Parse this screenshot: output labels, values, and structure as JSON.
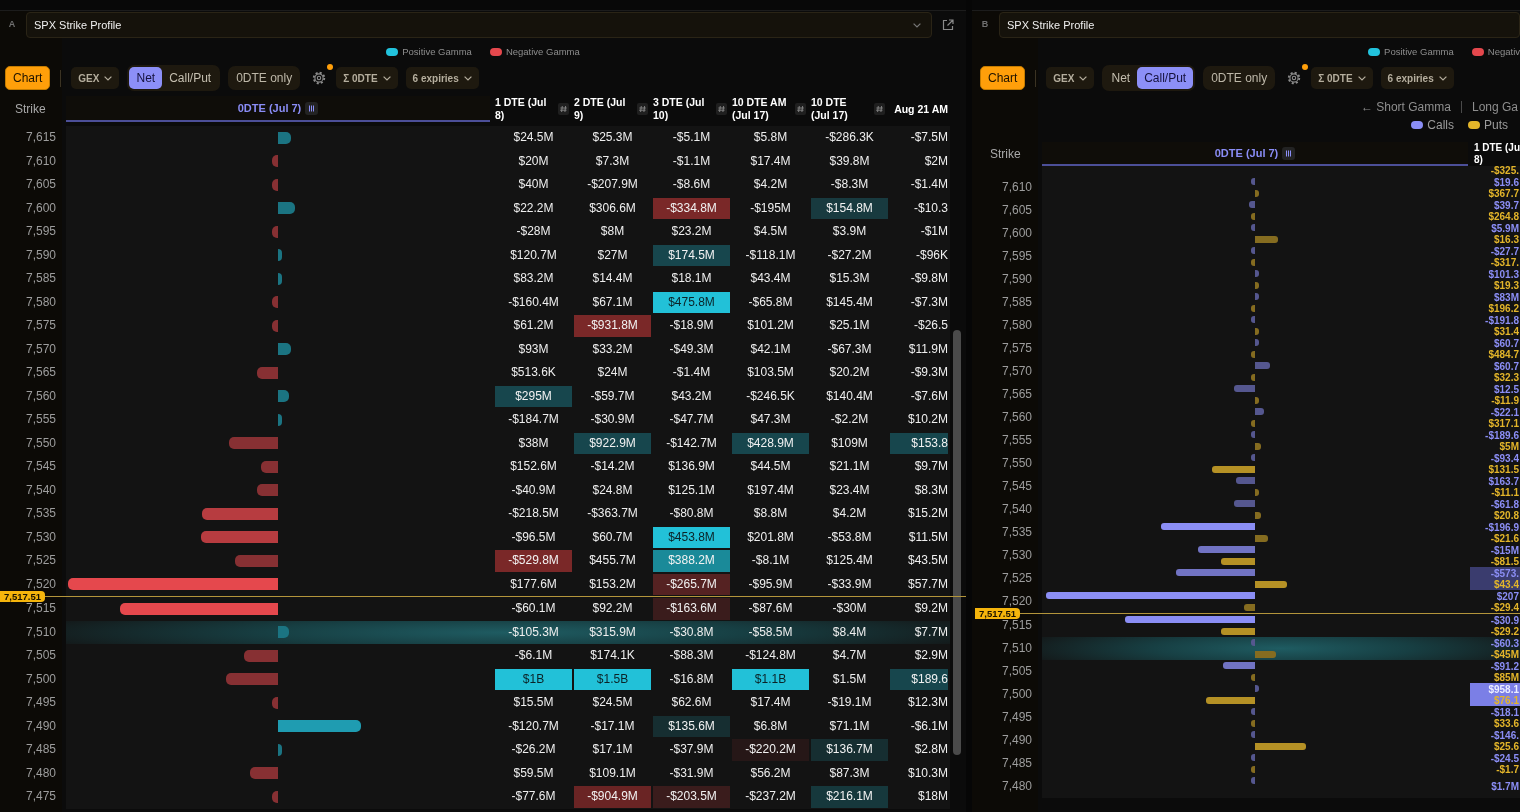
{
  "panels": [
    {
      "kind": "net",
      "label": "A",
      "title": "SPX Strike Profile",
      "title_menu": true,
      "popout": true,
      "legend": [
        {
          "label": "Positive Gamma",
          "color": "#22c3dd"
        },
        {
          "label": "Negative Gamma",
          "color": "#e5484d"
        }
      ],
      "toolbar": {
        "view": "Chart",
        "metric": "GEX",
        "modes": [
          {
            "label": "Net",
            "selected": true
          },
          {
            "label": "Call/Put",
            "selected": false
          }
        ],
        "filter": "0DTE only",
        "settings_badge": true,
        "aggregate": "Σ 0DTE",
        "expiries": "6 expiries"
      },
      "columns": {
        "strike": "Strike",
        "chart": "0DTE (Jul 7)",
        "expiries": [
          "1 DTE (Jul\n8)",
          "2 DTE (Jul\n9)",
          "3 DTE (Jul\n10)",
          "10 DTE AM\n(Jul 17)",
          "10 DTE\n(Jul 17)",
          "Aug 21 AM"
        ]
      },
      "rows": [
        {
          "strike": "7,615",
          "cells": [
            "$24.5M",
            "$25.3M",
            "-$5.1M",
            "$5.8M",
            "-$286.3K",
            "-$7.5M"
          ],
          "highlighted": false
        },
        {
          "strike": "7,610",
          "cells": [
            "$20M",
            "$7.3M",
            "-$1.1M",
            "$17.4M",
            "$39.8M",
            "$2M"
          ],
          "highlighted": false
        },
        {
          "strike": "7,605",
          "cells": [
            "$40M",
            "-$207.9M",
            "-$8.6M",
            "$4.2M",
            "-$8.3M",
            "-$1.4M"
          ],
          "highlighted": false
        },
        {
          "strike": "7,600",
          "cells": [
            "$22.2M",
            "$306.6M",
            {
              "text": "-$334.8M",
              "color": "#7a2828"
            },
            "-$195M",
            {
              "text": "$154.8M",
              "color": "#183a3f"
            },
            "-$10.3"
          ],
          "highlighted": false
        },
        {
          "strike": "7,595",
          "cells": [
            "-$28M",
            "$8M",
            "$23.2M",
            "$4.5M",
            "$3.9M",
            "-$1M"
          ],
          "highlighted": false
        },
        {
          "strike": "7,590",
          "cells": [
            "$120.7M",
            "$27M",
            {
              "text": "$174.5M",
              "color": "#17464d"
            },
            "-$118.1M",
            "-$27.2M",
            "-$96K"
          ],
          "highlighted": false
        },
        {
          "strike": "7,585",
          "cells": [
            "$83.2M",
            "$14.4M",
            "$18.1M",
            "$43.4M",
            "$15.3M",
            "-$9.8M"
          ],
          "highlighted": false
        },
        {
          "strike": "7,580",
          "cells": [
            "-$160.4M",
            "$67.1M",
            {
              "text": "$475.8M",
              "color": "#22c1d8"
            },
            "-$65.8M",
            "$145.4M",
            "-$7.3M"
          ],
          "highlighted": false
        },
        {
          "strike": "7,575",
          "cells": [
            "$61.2M",
            {
              "text": "-$931.8M",
              "color": "#7a2828"
            },
            "-$18.9M",
            "$101.2M",
            "$25.1M",
            "-$26.5"
          ],
          "highlighted": false
        },
        {
          "strike": "7,570",
          "cells": [
            "$93M",
            "$33.2M",
            "-$49.3M",
            "$42.1M",
            "-$67.3M",
            "$11.9M"
          ],
          "highlighted": false
        },
        {
          "strike": "7,565",
          "cells": [
            "$513.6K",
            "$24M",
            "-$1.4M",
            "$103.5M",
            "$20.2M",
            "-$9.3M"
          ],
          "highlighted": false
        },
        {
          "strike": "7,560",
          "cells": [
            {
              "text": "$295M",
              "color": "#17464d"
            },
            "-$59.7M",
            "$43.2M",
            "-$246.5K",
            "$140.4M",
            "-$7.6M"
          ],
          "highlighted": false
        },
        {
          "strike": "7,555",
          "cells": [
            "-$184.7M",
            "-$30.9M",
            "-$47.7M",
            "$47.3M",
            "-$2.2M",
            "$10.2M"
          ],
          "highlighted": false
        },
        {
          "strike": "7,550",
          "cells": [
            "$38M",
            {
              "text": "$922.9M",
              "color": "#17464d"
            },
            "-$142.7M",
            {
              "text": "$428.9M",
              "color": "#17464d"
            },
            "$109M",
            {
              "text": "$153.8",
              "color": "#17464d"
            }
          ],
          "highlighted": false
        },
        {
          "strike": "7,545",
          "cells": [
            "$152.6M",
            "-$14.2M",
            "$136.9M",
            "$44.5M",
            "$21.1M",
            "$9.7M"
          ],
          "highlighted": false
        },
        {
          "strike": "7,540",
          "cells": [
            "-$40.9M",
            "$24.8M",
            "$125.1M",
            "$197.4M",
            "$23.4M",
            "$8.3M"
          ],
          "highlighted": false
        },
        {
          "strike": "7,535",
          "cells": [
            "-$218.5M",
            "-$363.7M",
            "-$80.8M",
            "$8.8M",
            "$4.2M",
            "$15.2M"
          ],
          "highlighted": false
        },
        {
          "strike": "7,530",
          "cells": [
            "-$96.5M",
            "$60.7M",
            {
              "text": "$453.8M",
              "color": "#22c1d8"
            },
            "$201.8M",
            "-$53.8M",
            "$11.5M"
          ],
          "highlighted": false
        },
        {
          "strike": "7,525",
          "cells": [
            {
              "text": "-$529.8M",
              "color": "#7a2828"
            },
            "$455.7M",
            {
              "text": "$388.2M",
              "color": "#1a8a99"
            },
            "-$8.1M",
            "$125.4M",
            "$43.5M"
          ],
          "highlighted": false
        },
        {
          "strike": "7,520",
          "cells": [
            "$177.6M",
            "$153.2M",
            {
              "text": "-$265.7M",
              "color": "#552222"
            },
            "-$95.9M",
            "-$33.9M",
            "$57.7M"
          ],
          "highlighted": false,
          "price_marker": "7,517.51"
        },
        {
          "strike": "7,515",
          "cells": [
            "-$60.1M",
            "$92.2M",
            {
              "text": "-$163.6M",
              "color": "#3a1c1c"
            },
            "-$87.6M",
            "-$30M",
            "$9.2M"
          ],
          "highlighted": false
        },
        {
          "strike": "7,510",
          "cells": [
            "-$105.3M",
            "$315.9M",
            "-$30.8M",
            "-$58.5M",
            "$8.4M",
            "$7.7M"
          ],
          "highlighted": true
        },
        {
          "strike": "7,505",
          "cells": [
            "-$6.1M",
            "$174.1K",
            "-$88.3M",
            "-$124.8M",
            "$4.7M",
            "$2.9M"
          ],
          "highlighted": false
        },
        {
          "strike": "7,500",
          "cells": [
            {
              "text": "$1B",
              "color": "#22c1d8"
            },
            {
              "text": "$1.5B",
              "color": "#22c1d8"
            },
            "-$16.8M",
            {
              "text": "$1.1B",
              "color": "#22c1d8"
            },
            "$1.5M",
            {
              "text": "$189.6",
              "color": "#17464d"
            }
          ],
          "highlighted": false
        },
        {
          "strike": "7,495",
          "cells": [
            "$15.5M",
            "$24.5M",
            "$62.6M",
            "$17.4M",
            "-$19.1M",
            "$12.3M"
          ],
          "highlighted": false
        },
        {
          "strike": "7,490",
          "cells": [
            "-$120.7M",
            "-$17.1M",
            {
              "text": "$135.6M",
              "color": "#162e31"
            },
            "$6.8M",
            "$71.1M",
            "-$6.1M"
          ],
          "highlighted": false
        },
        {
          "strike": "7,485",
          "cells": [
            "-$26.2M",
            "$17.1M",
            "-$37.9M",
            {
              "text": "-$220.2M",
              "color": "#261717"
            },
            {
              "text": "$136.7M",
              "color": "#162e31"
            },
            "$2.8M"
          ],
          "highlighted": false
        },
        {
          "strike": "7,480",
          "cells": [
            "$59.5M",
            "$109.1M",
            "-$31.9M",
            "$56.2M",
            "$87.3M",
            "$10.3M"
          ],
          "highlighted": false
        },
        {
          "strike": "7,475",
          "cells": [
            "-$77.6M",
            {
              "text": "-$904.9M",
              "color": "#6a2424"
            },
            {
              "text": "-$203.5M",
              "color": "#3a1c1c"
            },
            "-$237.2M",
            {
              "text": "$216.1M",
              "color": "#16383c"
            },
            "$18M"
          ],
          "highlighted": false
        }
      ]
    },
    {
      "kind": "call_put",
      "label": "B",
      "title": "SPX Strike Profile",
      "legend": [
        {
          "label": "Positive Gamma",
          "color": "#22c3dd"
        },
        {
          "label": "Negativ",
          "color": "#e5484d"
        }
      ],
      "toolbar": {
        "view": "Chart",
        "metric": "GEX",
        "modes": [
          {
            "label": "Net",
            "selected": false
          },
          {
            "label": "Call/Put",
            "selected": true
          }
        ],
        "filter": "0DTE only",
        "settings_badge": true,
        "aggregate": "Σ 0DTE",
        "expiries": "6 expiries"
      },
      "axis_labels": [
        "← Short Gamma",
        "Long Ga"
      ],
      "series": [
        {
          "label": "Calls",
          "color": "#8b8ef5"
        },
        {
          "label": "Puts",
          "color": "#e3b52a"
        }
      ],
      "columns": {
        "strike": "Strike",
        "chart": "0DTE (Jul 7)",
        "expiries": [
          "1 DTE (Ju\n8)"
        ]
      },
      "clipped_value": "-$325.",
      "rows": [
        {
          "strike": "7,610",
          "values": [
            "$19.6",
            "$367.7"
          ],
          "highlighted": false
        },
        {
          "strike": "7,605",
          "values": [
            "$39.7",
            "$264.8"
          ],
          "highlighted": false
        },
        {
          "strike": "7,600",
          "values": [
            "$5.9M",
            "$16.3"
          ],
          "highlighted": false
        },
        {
          "strike": "7,595",
          "values": [
            "-$27.7",
            "-$317."
          ],
          "highlighted": false
        },
        {
          "strike": "7,590",
          "values": [
            "$101.3",
            "$19.3"
          ],
          "highlighted": false
        },
        {
          "strike": "7,585",
          "values": [
            "$83M",
            "$196.2"
          ],
          "highlighted": false
        },
        {
          "strike": "7,580",
          "values": [
            "-$191.8",
            "$31.4"
          ],
          "highlighted": false
        },
        {
          "strike": "7,575",
          "values": [
            "$60.7",
            "$484.7"
          ],
          "highlighted": false
        },
        {
          "strike": "7,570",
          "values": [
            "$60.7",
            "$32.3"
          ],
          "highlighted": false
        },
        {
          "strike": "7,565",
          "values": [
            "$12.5",
            "-$11.9"
          ],
          "highlighted": false
        },
        {
          "strike": "7,560",
          "values": [
            "-$22.1",
            "$317.1"
          ],
          "highlighted": false
        },
        {
          "strike": "7,555",
          "values": [
            "-$189.6",
            "$5M"
          ],
          "highlighted": false
        },
        {
          "strike": "7,550",
          "values": [
            "-$93.4",
            "$131.5"
          ],
          "highlighted": false
        },
        {
          "strike": "7,545",
          "values": [
            "$163.7",
            "-$11.1"
          ],
          "highlighted": false
        },
        {
          "strike": "7,540",
          "values": [
            "-$61.8",
            "$20.8"
          ],
          "highlighted": false
        },
        {
          "strike": "7,535",
          "values": [
            "-$196.9",
            "-$21.6"
          ],
          "highlighted": false
        },
        {
          "strike": "7,530",
          "values": [
            "-$15M",
            "-$81.5"
          ],
          "highlighted": false
        },
        {
          "strike": "7,525",
          "values": [
            "-$573.",
            "$43.4"
          ],
          "highlighted": false,
          "color": "#3a3c6e"
        },
        {
          "strike": "7,520",
          "values": [
            "$207",
            "-$29.4"
          ],
          "highlighted": false,
          "price_marker": "7,517.51"
        },
        {
          "strike": "7,515",
          "values": [
            "-$30.9",
            "-$29.2"
          ],
          "highlighted": false
        },
        {
          "strike": "7,510",
          "values": [
            "-$60.3",
            "-$45M"
          ],
          "highlighted": true
        },
        {
          "strike": "7,505",
          "values": [
            "-$91.2",
            "$85M"
          ],
          "highlighted": false
        },
        {
          "strike": "7,500",
          "values": [
            "$958.1",
            "$76.1"
          ],
          "highlighted": false,
          "color": "#7b7fe6"
        },
        {
          "strike": "7,495",
          "values": [
            "-$18.1",
            "$33.6"
          ],
          "highlighted": false
        },
        {
          "strike": "7,490",
          "values": [
            "-$146.",
            "$25.6"
          ],
          "highlighted": false
        },
        {
          "strike": "7,485",
          "values": [
            "-$24.5",
            "-$1.7"
          ],
          "highlighted": false
        },
        {
          "strike": "7,480",
          "values": [
            "$1.7M"
          ],
          "highlighted": false
        }
      ]
    }
  ]
}
